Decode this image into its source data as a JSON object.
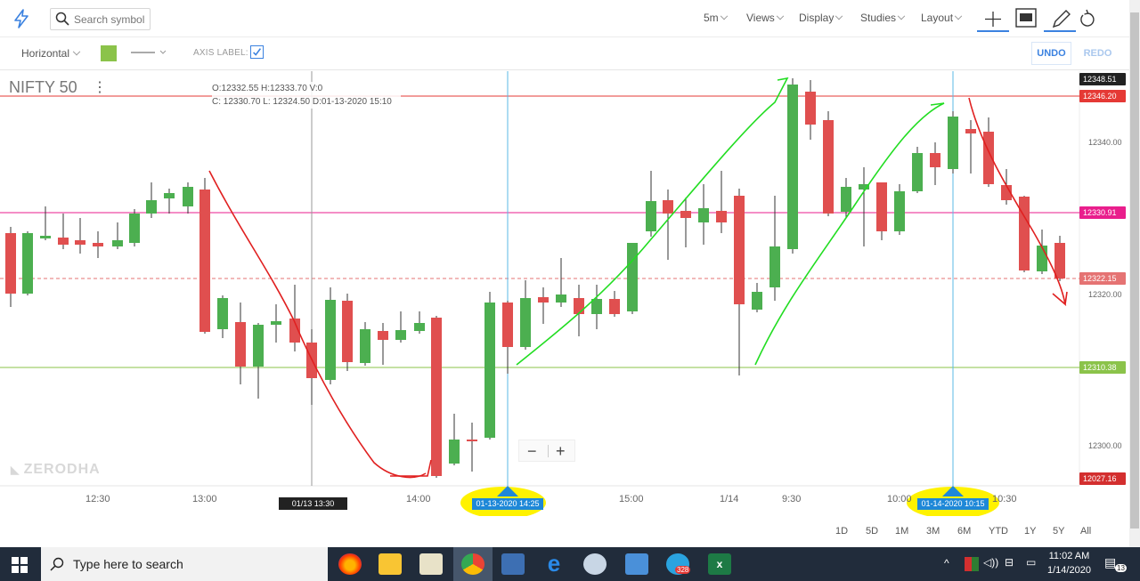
{
  "topbar": {
    "logo_icon": "bolt-icon",
    "search": {
      "placeholder": "Search symbol"
    },
    "menus": {
      "interval": "5m",
      "views": "Views",
      "display": "Display",
      "studies": "Studies",
      "layout": "Layout"
    },
    "tools": [
      "crosshair-icon",
      "chart-comment-icon",
      "pencil-icon",
      "reset-icon"
    ]
  },
  "drawbar": {
    "line_type": "Horizontal",
    "swatch_color": "#8bc34a",
    "axis_label_text": "AXIS LABEL:",
    "axis_label_checked": true,
    "undo_label": "UNDO",
    "redo_label": "REDO"
  },
  "chart": {
    "symbol": "NIFTY 50",
    "ohlc_line1": {
      "o": "O:12332.55",
      "h": "H:12333.70",
      "v": "V:0"
    },
    "ohlc_line2": {
      "c": "C: 12330.70",
      "l": "L: 12324.50",
      "d": "D:01-13-2020 15:10"
    },
    "watermark": "ZERODHA",
    "zoom_minus": "−",
    "zoom_plus": "+"
  },
  "price_tags": {
    "high": "12348.51",
    "red_line": "12346.20",
    "pink_line": "12330.91",
    "dashed_line": "12322.15",
    "green_line": "12310.38",
    "low": "12027.16"
  },
  "price_ticks": [
    "12340.00",
    "12320.00",
    "12300.00"
  ],
  "time_ticks": [
    "12:30",
    "13:00",
    "14:00",
    "15:00",
    "1/14",
    "9:30",
    "10:00",
    "10:30"
  ],
  "crosshair_label": "01/13 13:30",
  "vertical_markers": [
    "01-13-2020 14:25",
    "01-14-2020 10:15"
  ],
  "range_buttons": [
    "1D",
    "5D",
    "1M",
    "3M",
    "6M",
    "YTD",
    "1Y",
    "5Y",
    "All"
  ],
  "colors": {
    "up": "#4caf50",
    "down": "#e04f4f",
    "accent": "#3b82e0",
    "red_line": "#e53935",
    "pink_line": "#e91e8c",
    "green_line": "#8bc34a",
    "highlight": "#fff200"
  },
  "taskbar": {
    "search_text": "Type here to search",
    "apps": [
      "firefox-icon",
      "file-explorer-icon",
      "notepad-icon",
      "chrome-icon",
      "media-player-icon",
      "edge-icon",
      "paint-icon",
      "sketch-icon",
      "telegram-icon",
      "excel-icon"
    ],
    "telegram_badge": "328",
    "time": "11:02 AM",
    "date": "1/14/2020",
    "notification_count": "13"
  }
}
